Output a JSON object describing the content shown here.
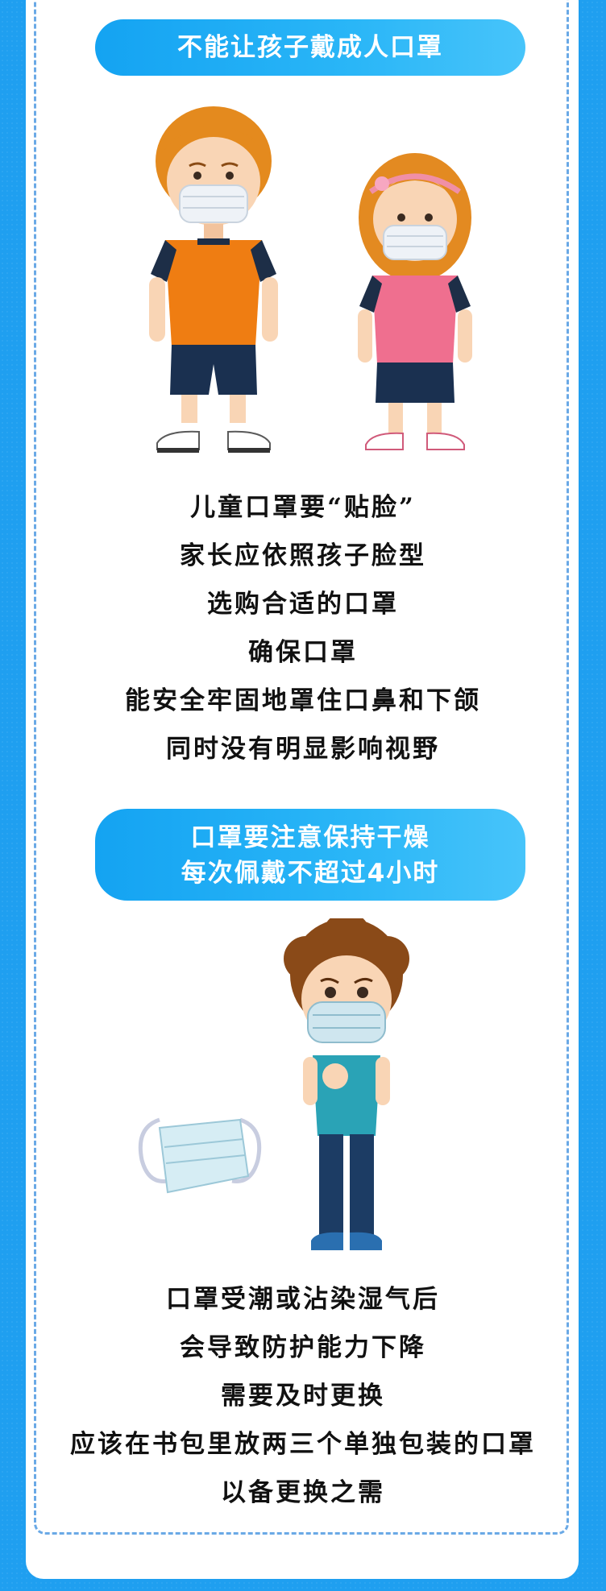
{
  "section1": {
    "heading": "不能让孩子戴成人口罩",
    "lines": [
      "儿童口罩要“贴脸”",
      "家长应依照孩子脸型",
      "选购合适的口罩",
      "确保口罩",
      "能安全牢固地罩住口鼻和下颌",
      "同时没有明显影响视野"
    ]
  },
  "section2": {
    "heading_line1": "口罩要注意保持干燥",
    "heading_line2": "每次佩戴不超过4小时",
    "lines": [
      "口罩受潮或沾染湿气后",
      "会导致防护能力下降",
      "需要及时更换",
      "应该在书包里放两三个单独包装的口罩",
      "以备更换之需"
    ]
  },
  "colors": {
    "background": "#1f9ff0",
    "card": "#ffffff",
    "pill": "#14a3f2",
    "dashed_border": "#6aa9e6"
  }
}
